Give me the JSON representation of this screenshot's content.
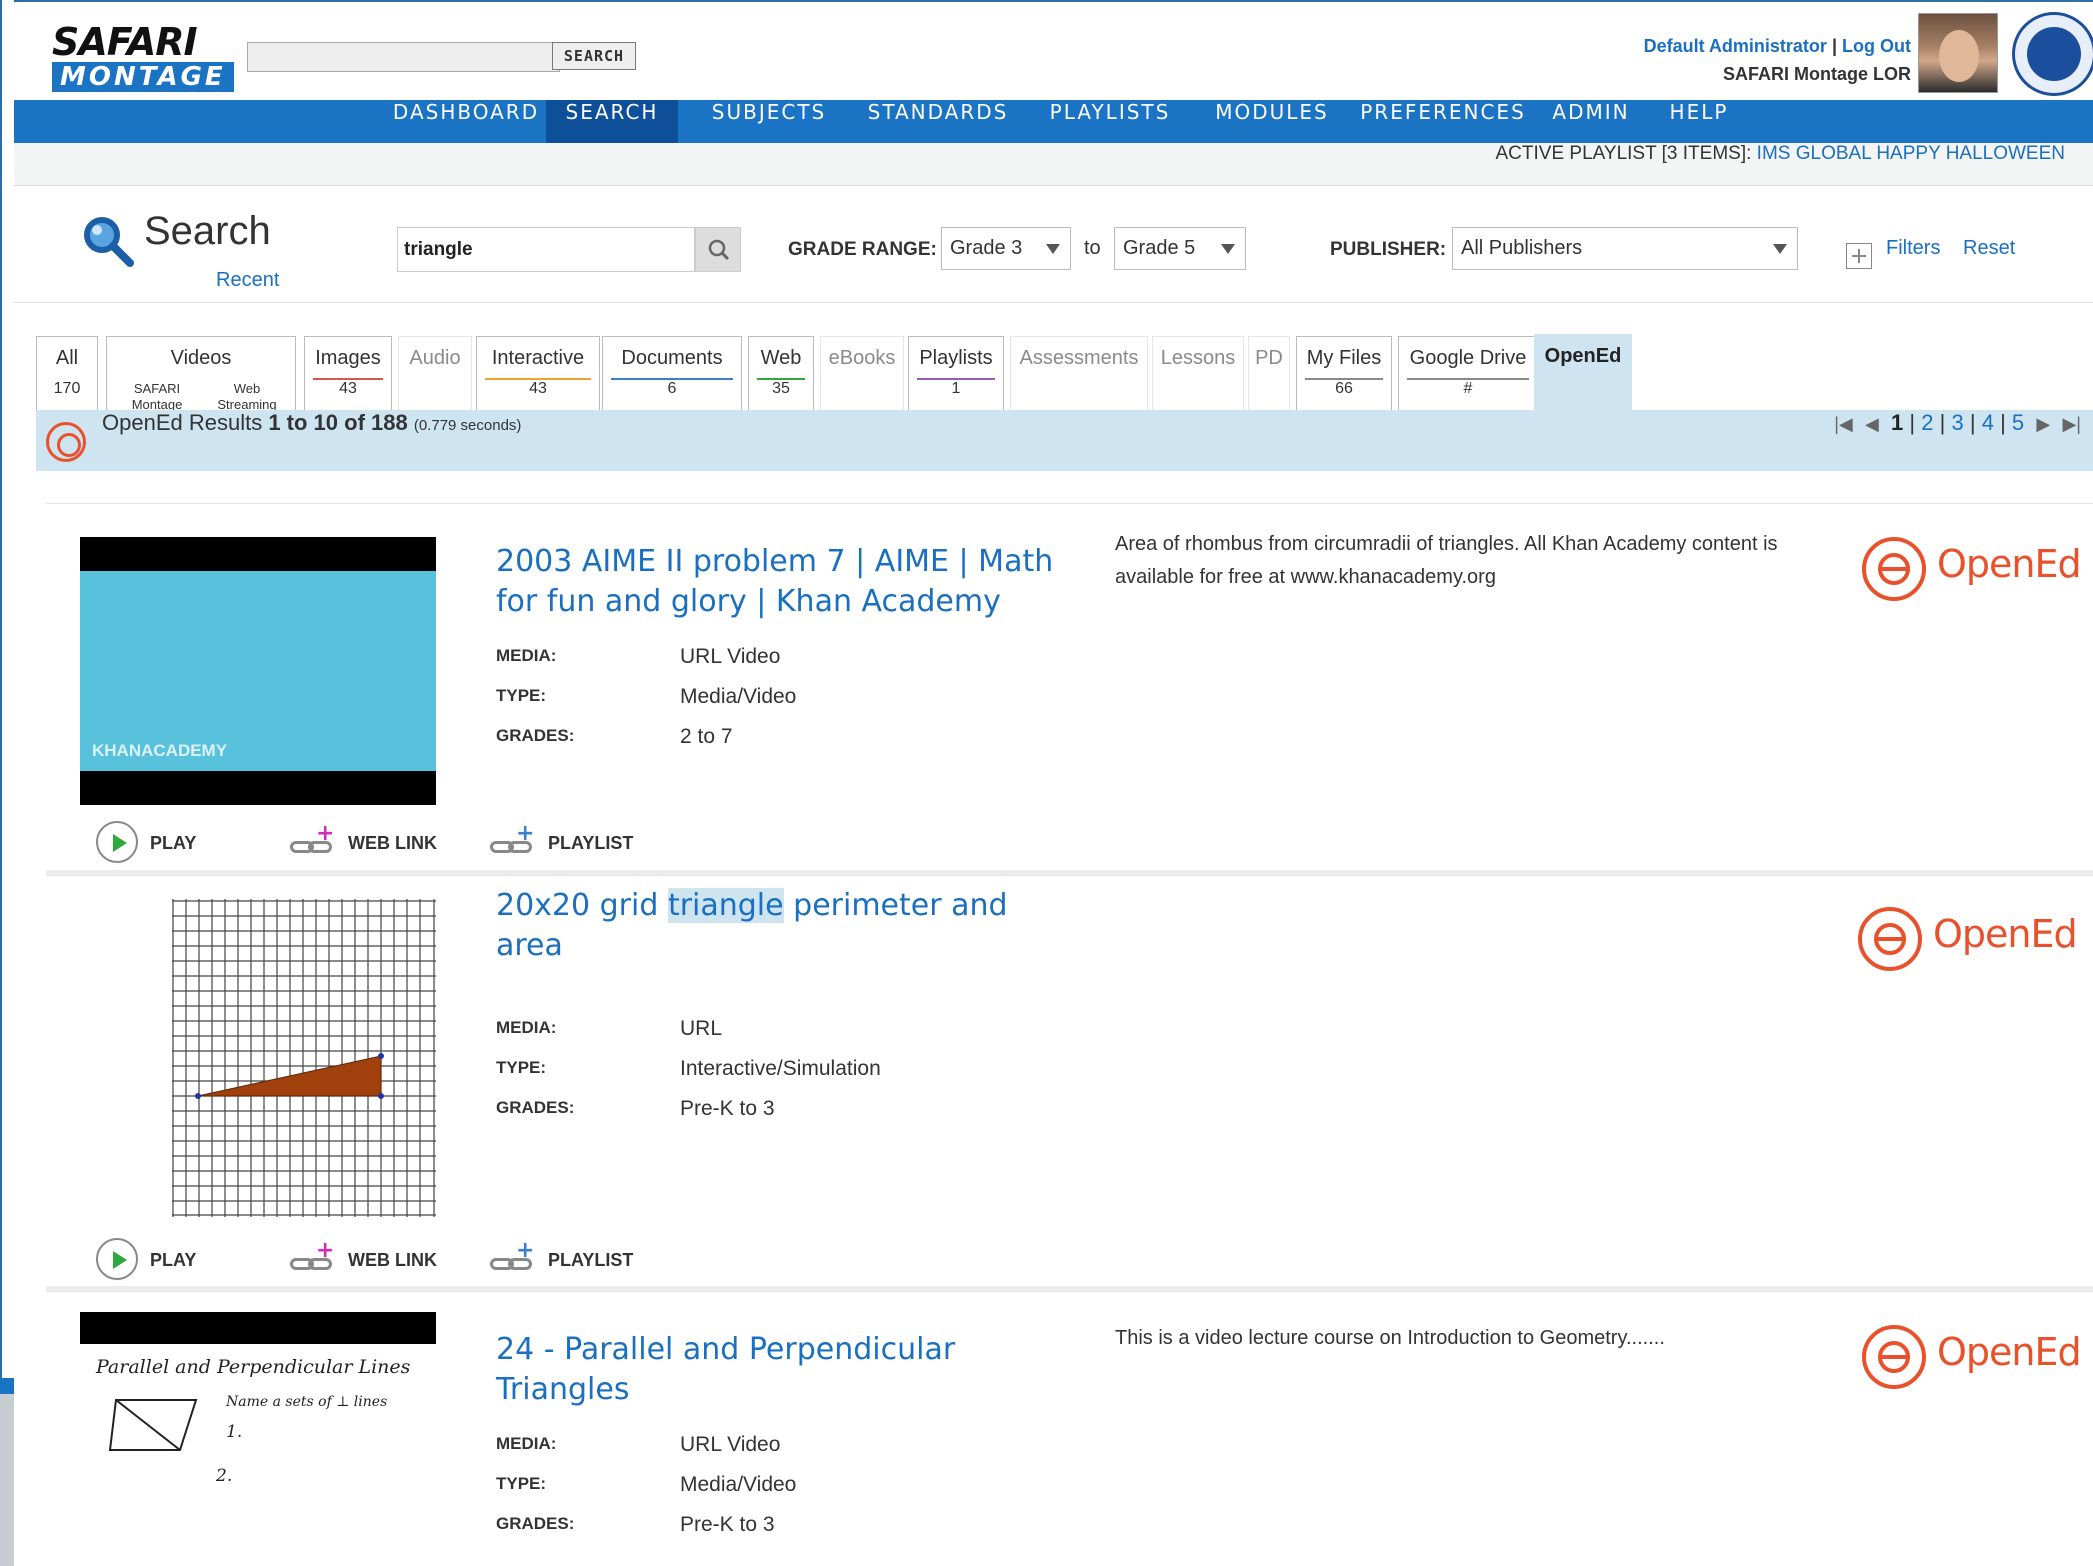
{
  "header": {
    "logo_top": "SAFARI",
    "logo_bottom": "MONTAGE",
    "search_button": "SEARCH",
    "user_name": "Default Administrator",
    "separator": "|",
    "logout": "Log Out",
    "site_name": "SAFARI Montage LOR"
  },
  "nav": {
    "items": [
      "DASHBOARD",
      "SEARCH",
      "SUBJECTS",
      "STANDARDS",
      "PLAYLISTS",
      "MODULES",
      "PREFERENCES",
      "ADMIN",
      "HELP"
    ],
    "active": "SEARCH"
  },
  "active_playlist": {
    "label": "ACTIVE PLAYLIST [3 ITEMS]:",
    "name": "IMS GLOBAL HAPPY HALLOWEEN"
  },
  "search": {
    "title": "Search",
    "recent": "Recent",
    "query": "triangle",
    "grade_label": "GRADE RANGE:",
    "grade_from": "Grade 3",
    "grade_to_word": "to",
    "grade_to": "Grade 5",
    "publisher_label": "PUBLISHER:",
    "publisher": "All Publishers",
    "filters": "Filters",
    "reset": "Reset"
  },
  "tabs": [
    {
      "label": "All",
      "count": "170"
    },
    {
      "label": "Videos",
      "sub1": "SAFARI Montage",
      "sub2": "Web Streaming"
    },
    {
      "label": "Images",
      "count": "43"
    },
    {
      "label": "Audio",
      "count": ""
    },
    {
      "label": "Interactive",
      "count": "43"
    },
    {
      "label": "Documents",
      "count": "6"
    },
    {
      "label": "Web",
      "count": "35"
    },
    {
      "label": "eBooks",
      "count": ""
    },
    {
      "label": "Playlists",
      "count": "1"
    },
    {
      "label": "Assessments",
      "count": ""
    },
    {
      "label": "Lessons",
      "count": ""
    },
    {
      "label": "PD",
      "count": ""
    },
    {
      "label": "My Files",
      "count": "66"
    },
    {
      "label": "Google Drive",
      "count": "#"
    },
    {
      "label": "OpenEd",
      "count": ""
    }
  ],
  "results_bar": {
    "prefix": "OpenEd Results",
    "range": "1 to 10 of 188",
    "time": "(0.779 seconds)",
    "pages": [
      "1",
      "2",
      "3",
      "4",
      "5"
    ],
    "current_page": "1"
  },
  "labels": {
    "media": "MEDIA:",
    "type": "TYPE:",
    "grades": "GRADES:",
    "play": "PLAY",
    "web_link": "WEB LINK",
    "playlist": "PLAYLIST",
    "opened_logo": "OpenEd"
  },
  "results": [
    {
      "title": "2003 AIME II problem 7 | AIME | Math for fun and glory | Khan Academy",
      "media": "URL Video",
      "type": "Media/Video",
      "grades": "2 to 7",
      "description": "Area of rhombus from circumradii of triangles. All Khan Academy content is available for free at www.khanacademy.org",
      "thumb_text": "KHANACADEMY"
    },
    {
      "title_before": "20x20 grid ",
      "title_highlight": "triangle",
      "title_after": " perimeter and area",
      "media": "URL",
      "type": "Interactive/Simulation",
      "grades": "Pre-K to 3",
      "description": ""
    },
    {
      "title": "24 - Parallel and Perpendicular Triangles",
      "media": "URL Video",
      "type": "Media/Video",
      "grades": "Pre-K to 3",
      "description": "This is a video lecture course on Introduction to Geometry.......",
      "thumb_title": "Parallel and Perpendicular Lines",
      "thumb_note": "Name a sets of ⊥ lines",
      "thumb_1": "1.",
      "thumb_2": "2."
    }
  ],
  "colors": {
    "brand_blue": "#1b73c4",
    "nav_active": "#0d4f99",
    "link": "#1a6fc0",
    "opened_orange": "#e8512b",
    "tab_active": "#cfe4f1"
  }
}
